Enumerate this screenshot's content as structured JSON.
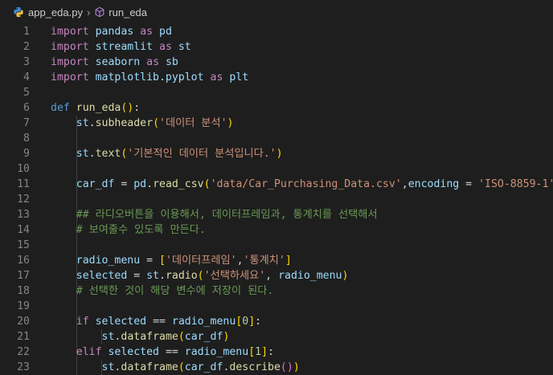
{
  "breadcrumb": {
    "file": "app_eda.py",
    "symbol": "run_eda"
  },
  "colors": {
    "background": "#1e1e1e",
    "keyword": "#569cd6",
    "control_keyword": "#c586c0",
    "identifier": "#9cdcfe",
    "function": "#dcdcaa",
    "string": "#ce9178",
    "number": "#b5cea8",
    "comment": "#6a9955",
    "line_number": "#858585"
  },
  "editor": {
    "lines": [
      {
        "n": "1",
        "indent": 0,
        "t": [
          [
            "kwc",
            "import"
          ],
          [
            "pn",
            " "
          ],
          [
            "id",
            "pandas"
          ],
          [
            "pn",
            " "
          ],
          [
            "kwc",
            "as"
          ],
          [
            "pn",
            " "
          ],
          [
            "id",
            "pd"
          ]
        ]
      },
      {
        "n": "2",
        "indent": 0,
        "t": [
          [
            "kwc",
            "import"
          ],
          [
            "pn",
            " "
          ],
          [
            "id",
            "streamlit"
          ],
          [
            "pn",
            " "
          ],
          [
            "kwc",
            "as"
          ],
          [
            "pn",
            " "
          ],
          [
            "id",
            "st"
          ]
        ]
      },
      {
        "n": "3",
        "indent": 0,
        "t": [
          [
            "kwc",
            "import"
          ],
          [
            "pn",
            " "
          ],
          [
            "id",
            "seaborn"
          ],
          [
            "pn",
            " "
          ],
          [
            "kwc",
            "as"
          ],
          [
            "pn",
            " "
          ],
          [
            "id",
            "sb"
          ]
        ]
      },
      {
        "n": "4",
        "indent": 0,
        "t": [
          [
            "kwc",
            "import"
          ],
          [
            "pn",
            " "
          ],
          [
            "id",
            "matplotlib.pyplot"
          ],
          [
            "pn",
            " "
          ],
          [
            "kwc",
            "as"
          ],
          [
            "pn",
            " "
          ],
          [
            "id",
            "plt"
          ]
        ]
      },
      {
        "n": "5",
        "indent": 0,
        "t": []
      },
      {
        "n": "6",
        "indent": 0,
        "t": [
          [
            "kw",
            "def"
          ],
          [
            "pn",
            " "
          ],
          [
            "fn",
            "run_eda"
          ],
          [
            "br1",
            "()"
          ],
          [
            "pn",
            ":"
          ]
        ]
      },
      {
        "n": "7",
        "indent": 1,
        "t": [
          [
            "pn",
            "    "
          ],
          [
            "id",
            "st"
          ],
          [
            "pn",
            "."
          ],
          [
            "fn",
            "subheader"
          ],
          [
            "br1",
            "("
          ],
          [
            "str",
            "'데이터 분석'"
          ],
          [
            "br1",
            ")"
          ]
        ]
      },
      {
        "n": "8",
        "indent": 1,
        "t": []
      },
      {
        "n": "9",
        "indent": 1,
        "t": [
          [
            "pn",
            "    "
          ],
          [
            "id",
            "st"
          ],
          [
            "pn",
            "."
          ],
          [
            "fn",
            "text"
          ],
          [
            "br1",
            "("
          ],
          [
            "str",
            "'기본적인 데이터 분석입니다.'"
          ],
          [
            "br1",
            ")"
          ]
        ]
      },
      {
        "n": "10",
        "indent": 1,
        "t": []
      },
      {
        "n": "11",
        "indent": 1,
        "t": [
          [
            "pn",
            "    "
          ],
          [
            "id",
            "car_df"
          ],
          [
            "pn",
            " = "
          ],
          [
            "id",
            "pd"
          ],
          [
            "pn",
            "."
          ],
          [
            "fn",
            "read_csv"
          ],
          [
            "br1",
            "("
          ],
          [
            "str",
            "'data/Car_Purchasing_Data.csv'"
          ],
          [
            "pn",
            ","
          ],
          [
            "id",
            "encoding"
          ],
          [
            "pn",
            " = "
          ],
          [
            "str",
            "'ISO-8859-1'"
          ],
          [
            "br1",
            ")"
          ]
        ]
      },
      {
        "n": "12",
        "indent": 1,
        "t": []
      },
      {
        "n": "13",
        "indent": 1,
        "t": [
          [
            "pn",
            "    "
          ],
          [
            "cm",
            "## 라디오버튼을 이용해서, 데이터프레임과, 통계치를 선택해서"
          ]
        ]
      },
      {
        "n": "14",
        "indent": 1,
        "t": [
          [
            "pn",
            "    "
          ],
          [
            "cm",
            "# 보여줄수 있도록 만든다."
          ]
        ]
      },
      {
        "n": "15",
        "indent": 1,
        "t": []
      },
      {
        "n": "16",
        "indent": 1,
        "t": [
          [
            "pn",
            "    "
          ],
          [
            "id",
            "radio_menu"
          ],
          [
            "pn",
            " = "
          ],
          [
            "br1",
            "["
          ],
          [
            "str",
            "'데이터프레임'"
          ],
          [
            "pn",
            ","
          ],
          [
            "str",
            "'통계치'"
          ],
          [
            "br1",
            "]"
          ]
        ]
      },
      {
        "n": "17",
        "indent": 1,
        "t": [
          [
            "pn",
            "    "
          ],
          [
            "id",
            "selected"
          ],
          [
            "pn",
            " = "
          ],
          [
            "id",
            "st"
          ],
          [
            "pn",
            "."
          ],
          [
            "fn",
            "radio"
          ],
          [
            "br1",
            "("
          ],
          [
            "str",
            "'선택하세요'"
          ],
          [
            "pn",
            ", "
          ],
          [
            "id",
            "radio_menu"
          ],
          [
            "br1",
            ")"
          ]
        ]
      },
      {
        "n": "18",
        "indent": 1,
        "t": [
          [
            "pn",
            "    "
          ],
          [
            "cm",
            "# 선택한 것이 해당 변수에 저장이 된다."
          ]
        ]
      },
      {
        "n": "19",
        "indent": 1,
        "t": []
      },
      {
        "n": "20",
        "indent": 1,
        "t": [
          [
            "pn",
            "    "
          ],
          [
            "kwc",
            "if"
          ],
          [
            "pn",
            " "
          ],
          [
            "id",
            "selected"
          ],
          [
            "pn",
            " == "
          ],
          [
            "id",
            "radio_menu"
          ],
          [
            "br1",
            "["
          ],
          [
            "num",
            "0"
          ],
          [
            "br1",
            "]"
          ],
          [
            "pn",
            ":"
          ]
        ]
      },
      {
        "n": "21",
        "indent": 2,
        "t": [
          [
            "pn",
            "        "
          ],
          [
            "id",
            "st"
          ],
          [
            "pn",
            "."
          ],
          [
            "fn",
            "dataframe"
          ],
          [
            "br1",
            "("
          ],
          [
            "id",
            "car_df"
          ],
          [
            "br1",
            ")"
          ]
        ]
      },
      {
        "n": "22",
        "indent": 1,
        "t": [
          [
            "pn",
            "    "
          ],
          [
            "kwc",
            "elif"
          ],
          [
            "pn",
            " "
          ],
          [
            "id",
            "selected"
          ],
          [
            "pn",
            " == "
          ],
          [
            "id",
            "radio_menu"
          ],
          [
            "br1",
            "["
          ],
          [
            "num",
            "1"
          ],
          [
            "br1",
            "]"
          ],
          [
            "pn",
            ":"
          ]
        ]
      },
      {
        "n": "23",
        "indent": 2,
        "t": [
          [
            "pn",
            "        "
          ],
          [
            "id",
            "st"
          ],
          [
            "pn",
            "."
          ],
          [
            "fn",
            "dataframe"
          ],
          [
            "br1",
            "("
          ],
          [
            "id",
            "car_df"
          ],
          [
            "pn",
            "."
          ],
          [
            "fn",
            "describe"
          ],
          [
            "br2",
            "()"
          ],
          [
            "br1",
            ")"
          ]
        ]
      }
    ]
  }
}
